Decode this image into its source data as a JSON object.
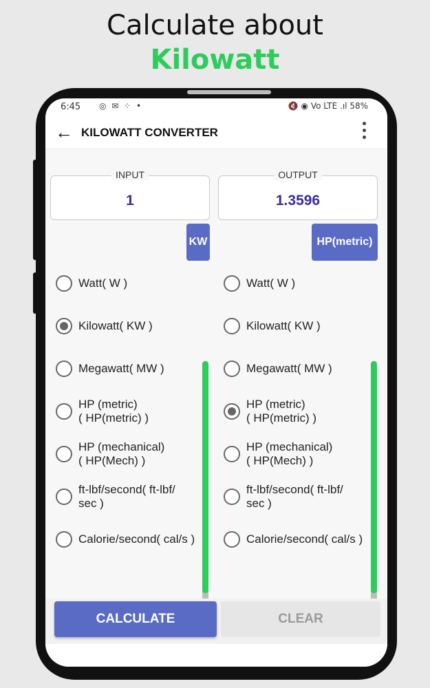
{
  "promo": {
    "line1": "Calculate about",
    "line2": "Kilowatt"
  },
  "status": {
    "time": "6:45",
    "icons": "◎ ✉ ⁘ •",
    "right": "🔇 ◉ Vo LTE .ıl 58%"
  },
  "appbar": {
    "title": "KILOWATT CONVERTER"
  },
  "input": {
    "label": "INPUT",
    "value": "1",
    "unit": "KW"
  },
  "output": {
    "label": "OUTPUT",
    "value": "1.3596",
    "unit": "HP(metric)"
  },
  "units": [
    {
      "line1": "Watt( W )",
      "line2": ""
    },
    {
      "line1": "Kilowatt( KW )",
      "line2": ""
    },
    {
      "line1": "Megawatt( MW )",
      "line2": ""
    },
    {
      "line1": "HP (metric)",
      "line2": "( HP(metric) )"
    },
    {
      "line1": "HP (mechanical)",
      "line2": "( HP(Mech) )"
    },
    {
      "line1": "ft-lbf/second( ft-lbf/",
      "line2": "sec )"
    },
    {
      "line1": "Calorie/second( cal/s )",
      "line2": ""
    }
  ],
  "input_selected_index": 1,
  "output_selected_index": 3,
  "buttons": {
    "calculate": "CALCULATE",
    "clear": "CLEAR"
  },
  "colors": {
    "accent": "#5a6bc6",
    "green": "#2ecc5a",
    "value_text": "#3a2aa0"
  }
}
